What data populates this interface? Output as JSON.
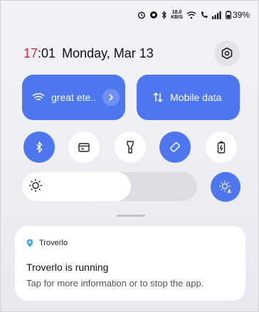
{
  "status_bar": {
    "net_speed_value": "18.0",
    "net_speed_unit": "KB/S",
    "battery": "39%"
  },
  "header": {
    "time_hours": "17",
    "time_rest": ":01",
    "date": "Monday, Mar 13"
  },
  "tiles": {
    "wifi_label": "great ete..",
    "mobile_label": "Mobile data"
  },
  "toggles": [
    {
      "name": "bluetooth",
      "state": "on"
    },
    {
      "name": "nfc-card",
      "state": "off"
    },
    {
      "name": "flashlight",
      "state": "off"
    },
    {
      "name": "auto-rotate",
      "state": "on"
    },
    {
      "name": "battery-saver",
      "state": "off"
    }
  ],
  "brightness": {
    "level_percent": 62
  },
  "notification": {
    "app_name": "Troverlo",
    "title": "Troverlo is running",
    "text": "Tap for more information or to stop the app."
  },
  "colors": {
    "accent": "#4d76ef",
    "time_hours": "#e0283a",
    "app_icon": "#3da7e6"
  }
}
